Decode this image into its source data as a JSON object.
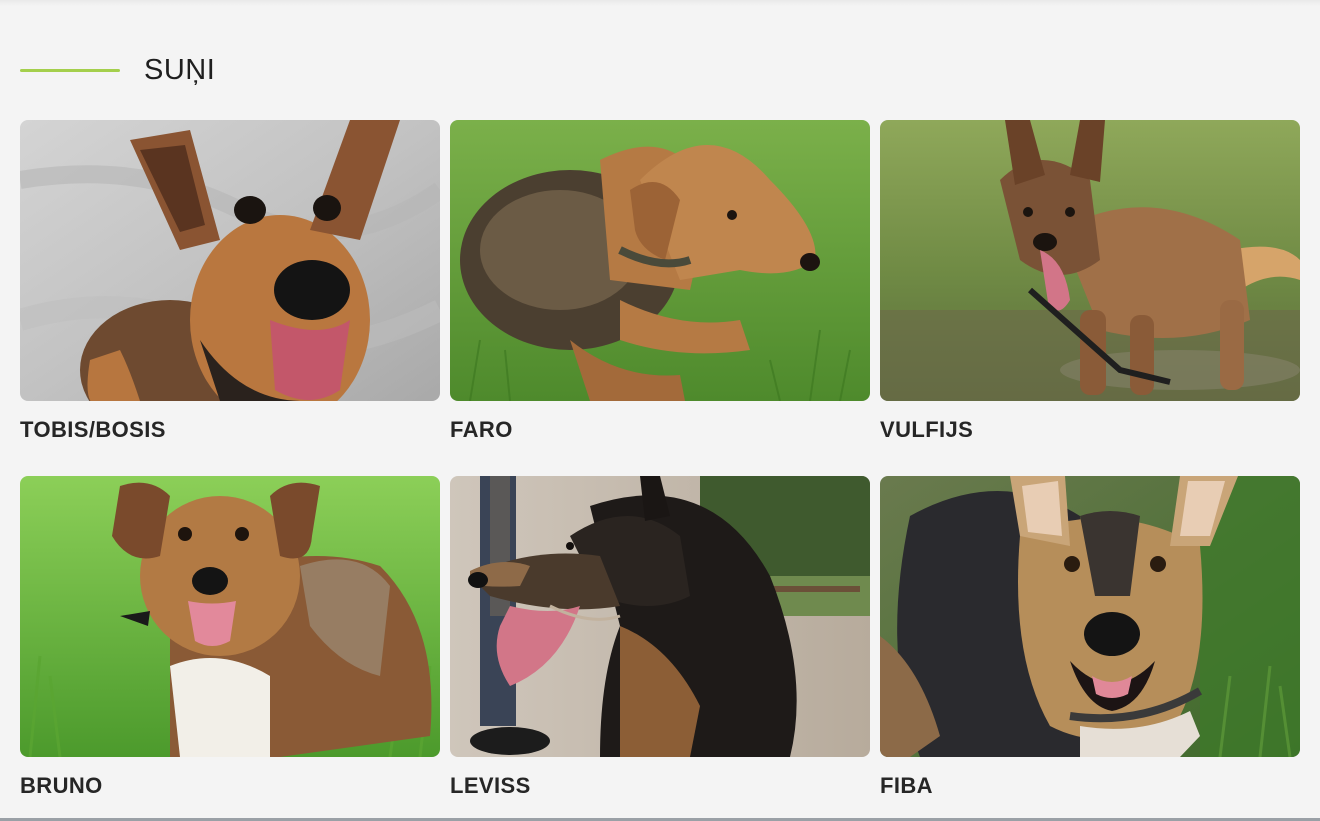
{
  "section": {
    "title": "SUŅI",
    "accent_color": "#a4cf4c"
  },
  "dogs": [
    {
      "name": "TOBIS/BOSIS",
      "photo_icon": "dog-photo-tobis"
    },
    {
      "name": "FARO",
      "photo_icon": "dog-photo-faro"
    },
    {
      "name": "VULFIJS",
      "photo_icon": "dog-photo-vulfijs"
    },
    {
      "name": "BRUNO",
      "photo_icon": "dog-photo-bruno"
    },
    {
      "name": "LEVISS",
      "photo_icon": "dog-photo-leviss"
    },
    {
      "name": "FIBA",
      "photo_icon": "dog-photo-fiba"
    }
  ]
}
